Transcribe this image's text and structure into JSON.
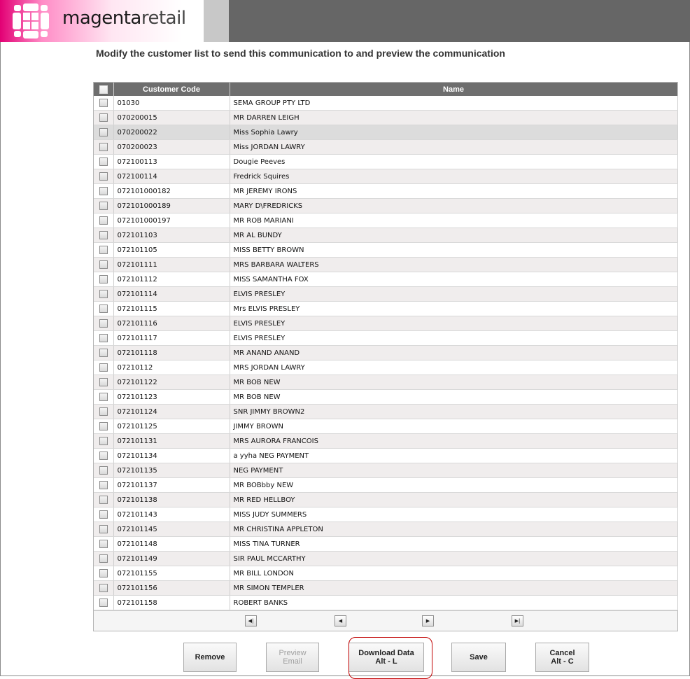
{
  "header": {
    "logo_bold": "magenta",
    "logo_light": "retail",
    "logo_icon": "magenta-grid-logo-icon"
  },
  "instructions": "Modify the customer list to send this communication to and preview the communication",
  "table": {
    "headers": [
      "",
      "Customer Code",
      "Name"
    ],
    "rows": [
      [
        "01030",
        "SEMA GROUP PTY LTD"
      ],
      [
        "070200015",
        "MR DARREN LEIGH"
      ],
      [
        "070200022",
        "Miss Sophia Lawry"
      ],
      [
        "070200023",
        "Miss JORDAN LAWRY"
      ],
      [
        "072100113",
        "Dougie Peeves"
      ],
      [
        "072100114",
        "Fredrick Squires"
      ],
      [
        "072101000182",
        "MR JEREMY IRONS"
      ],
      [
        "072101000189",
        "MARY D\\FREDRICKS"
      ],
      [
        "072101000197",
        "MR ROB MARIANI"
      ],
      [
        "072101103",
        "MR AL BUNDY"
      ],
      [
        "072101105",
        "MISS BETTY BROWN"
      ],
      [
        "072101111",
        "MRS BARBARA WALTERS"
      ],
      [
        "072101112",
        "MISS SAMANTHA FOX"
      ],
      [
        "072101114",
        "ELVIS PRESLEY"
      ],
      [
        "072101115",
        "Mrs ELVIS PRESLEY"
      ],
      [
        "072101116",
        "ELVIS PRESLEY"
      ],
      [
        "072101117",
        "ELVIS PRESLEY"
      ],
      [
        "072101118",
        "MR ANAND ANAND"
      ],
      [
        "07210112",
        "MRS JORDAN LAWRY"
      ],
      [
        "072101122",
        "MR BOB NEW"
      ],
      [
        "072101123",
        "MR BOB NEW"
      ],
      [
        "072101124",
        "SNR JIMMY BROWN2"
      ],
      [
        "072101125",
        "JIMMY BROWN"
      ],
      [
        "072101131",
        "MRS AURORA FRANCOIS"
      ],
      [
        "072101134",
        "a yyha NEG PAYMENT"
      ],
      [
        "072101135",
        "NEG PAYMENT"
      ],
      [
        "072101137",
        "MR BOBbby NEW"
      ],
      [
        "072101138",
        "MR RED HELLBOY"
      ],
      [
        "072101143",
        "MISS JUDY SUMMERS"
      ],
      [
        "072101145",
        "MR CHRISTINA APPLETON"
      ],
      [
        "072101148",
        "MISS TINA TURNER"
      ],
      [
        "072101149",
        "SIR PAUL MCCARTHY"
      ],
      [
        "072101155",
        "MR BILL LONDON"
      ],
      [
        "072101156",
        "MR SIMON TEMPLER"
      ],
      [
        "072101158",
        "ROBERT BANKS"
      ]
    ],
    "highlighted_row": 2
  },
  "pager": {
    "first_icon": "first-page-icon",
    "prev_icon": "previous-page-icon",
    "next_icon": "next-page-icon",
    "last_icon": "last-page-icon"
  },
  "buttons": {
    "remove": "Remove",
    "preview_line1": "Preview",
    "preview_line2": "Email",
    "download_line1": "Download Data",
    "download_line2": "Alt - L",
    "save": "Save",
    "cancel_line1": "Cancel",
    "cancel_line2": "Alt - C"
  },
  "colors": {
    "brand_magenta": "#e20074",
    "header_gray": "#666666",
    "focus_ring": "#c00000"
  }
}
